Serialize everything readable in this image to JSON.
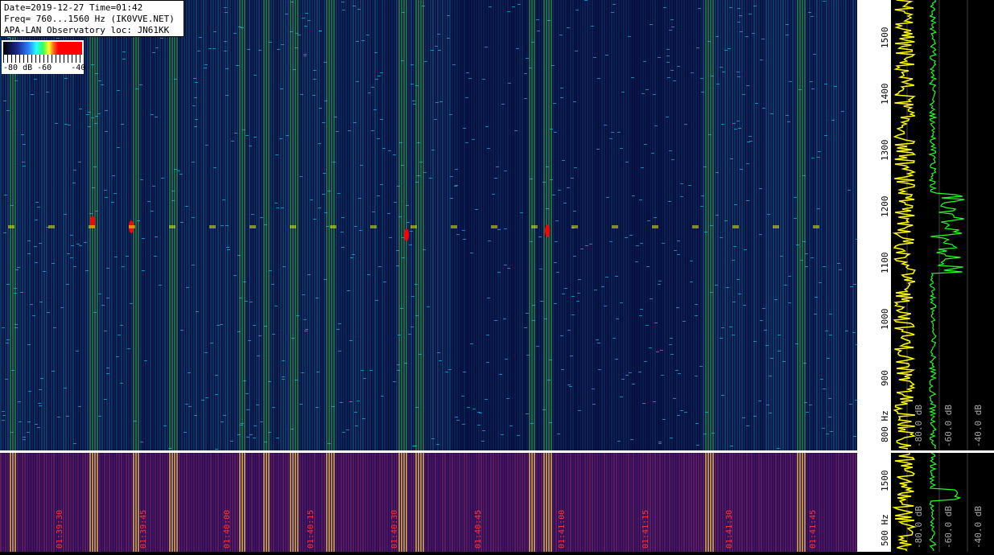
{
  "header": {
    "line1": "Date=2019-12-27 Time=01:42",
    "line2": "Freq= 760...1560 Hz (IK0VVE.NET)",
    "line3": "APA-LAN Observatory loc: JN61KK"
  },
  "legend": {
    "labels": "-80 dB -60    -40"
  },
  "chart_data": {
    "type": "heatmap",
    "title": "",
    "freq_range_hz": [
      760,
      1560
    ],
    "freq_ticks_top": [
      "1500",
      "1400",
      "1300",
      "1200",
      "1100",
      "1000",
      "900",
      "800 Hz"
    ],
    "freq_ticks_bottom": [
      "1500",
      "500 Hz"
    ],
    "db_labels_top": [
      "-80.0 dB",
      "-60.0 dB",
      "-40.0 dB"
    ],
    "db_labels_bottom": [
      "-80.0 dB",
      "-60.0 dB",
      "-40.0 dB"
    ],
    "time_labels": [
      "01:39:30",
      "01:39:45",
      "01:40:00",
      "01:40:15",
      "01:40:30",
      "01:40:45",
      "01:41:00",
      "01:41:15",
      "01:41:30",
      "01:41:45"
    ],
    "colorscale_db": [
      -80,
      -60,
      -40
    ]
  },
  "colors": {
    "background": "#050a3a",
    "signal_cyan": "#20d0ff",
    "signal_green": "#2fff5f",
    "peak_red": "#ff0000",
    "spectrum_yellow": "#ffff00",
    "spectrum_green": "#22ff22",
    "time_label_red": "#ff3333"
  }
}
